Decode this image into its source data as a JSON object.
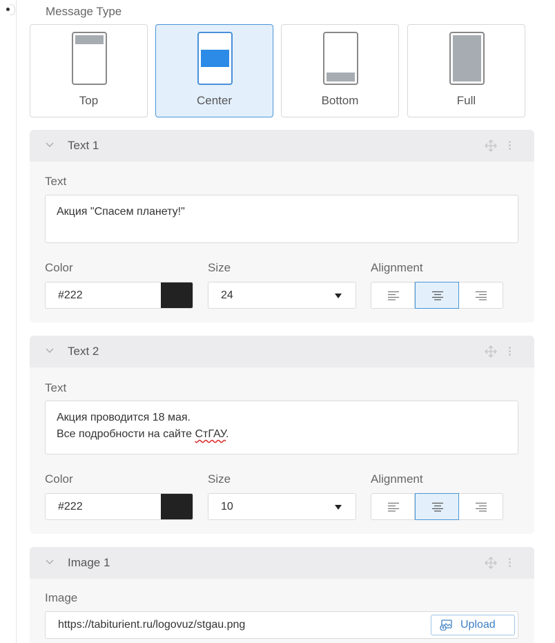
{
  "message_type": {
    "label": "Message Type",
    "options": [
      {
        "label": "Top",
        "selected": false
      },
      {
        "label": "Center",
        "selected": true
      },
      {
        "label": "Bottom",
        "selected": false
      },
      {
        "label": "Full",
        "selected": false
      }
    ]
  },
  "panels": [
    {
      "title": "Text 1",
      "text_label": "Text",
      "text_lines": [
        "Акция \"Спасем планету!\""
      ],
      "color_label": "Color",
      "color_value": "#222",
      "size_label": "Size",
      "size_value": "24",
      "alignment_label": "Alignment",
      "alignment": "center"
    },
    {
      "title": "Text 2",
      "text_label": "Text",
      "text_lines": [
        "Акция проводится 18 мая.",
        "Все подробности на сайте ",
        "СтГАУ",
        "."
      ],
      "color_label": "Color",
      "color_value": "#222",
      "size_label": "Size",
      "size_value": "10",
      "alignment_label": "Alignment",
      "alignment": "center"
    },
    {
      "title": "Image 1",
      "image_label": "Image",
      "image_url": "https://tabiturient.ru/logovuz/stgau.png",
      "upload_label": "Upload"
    }
  ],
  "colors": {
    "accent": "#4a95d6",
    "accent_fill": "#2b8be6",
    "selected_bg": "#e3f0fb",
    "swatch": "#222222"
  },
  "icons": [
    "chevron-down-icon",
    "move-icon",
    "more-vertical-icon",
    "align-left-icon",
    "align-center-icon",
    "align-right-icon",
    "upload-image-icon"
  ]
}
